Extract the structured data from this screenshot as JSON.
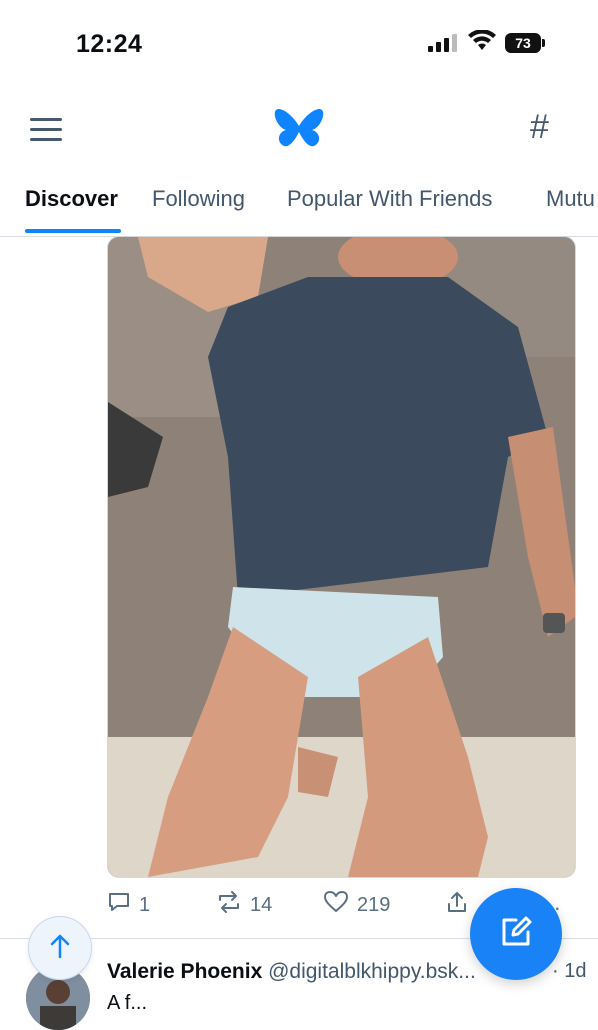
{
  "status_bar": {
    "time": "12:24",
    "battery": "73"
  },
  "header": {
    "logo": "butterfly-logo",
    "menu_icon": "hamburger-icon",
    "feeds_icon": "hash-icon"
  },
  "tabs": [
    {
      "label": "Discover",
      "active": true
    },
    {
      "label": "Following",
      "active": false
    },
    {
      "label": "Popular With Friends",
      "active": false
    },
    {
      "label": "Mutu",
      "active": false
    }
  ],
  "post": {
    "image_description": "person lying on couch wearing navy t-shirt",
    "actions": {
      "replies": "1",
      "reposts": "14",
      "likes": "219",
      "more": "..."
    }
  },
  "next_post": {
    "name": "Valerie Phoenix",
    "handle": "@digitalblkhippy.bsk...",
    "separator": "·",
    "age": "1d",
    "text": "A f..."
  },
  "colors": {
    "accent": "#1083fe",
    "compose_button": "#1a82f7",
    "icon_gray": "#5b6f84"
  }
}
